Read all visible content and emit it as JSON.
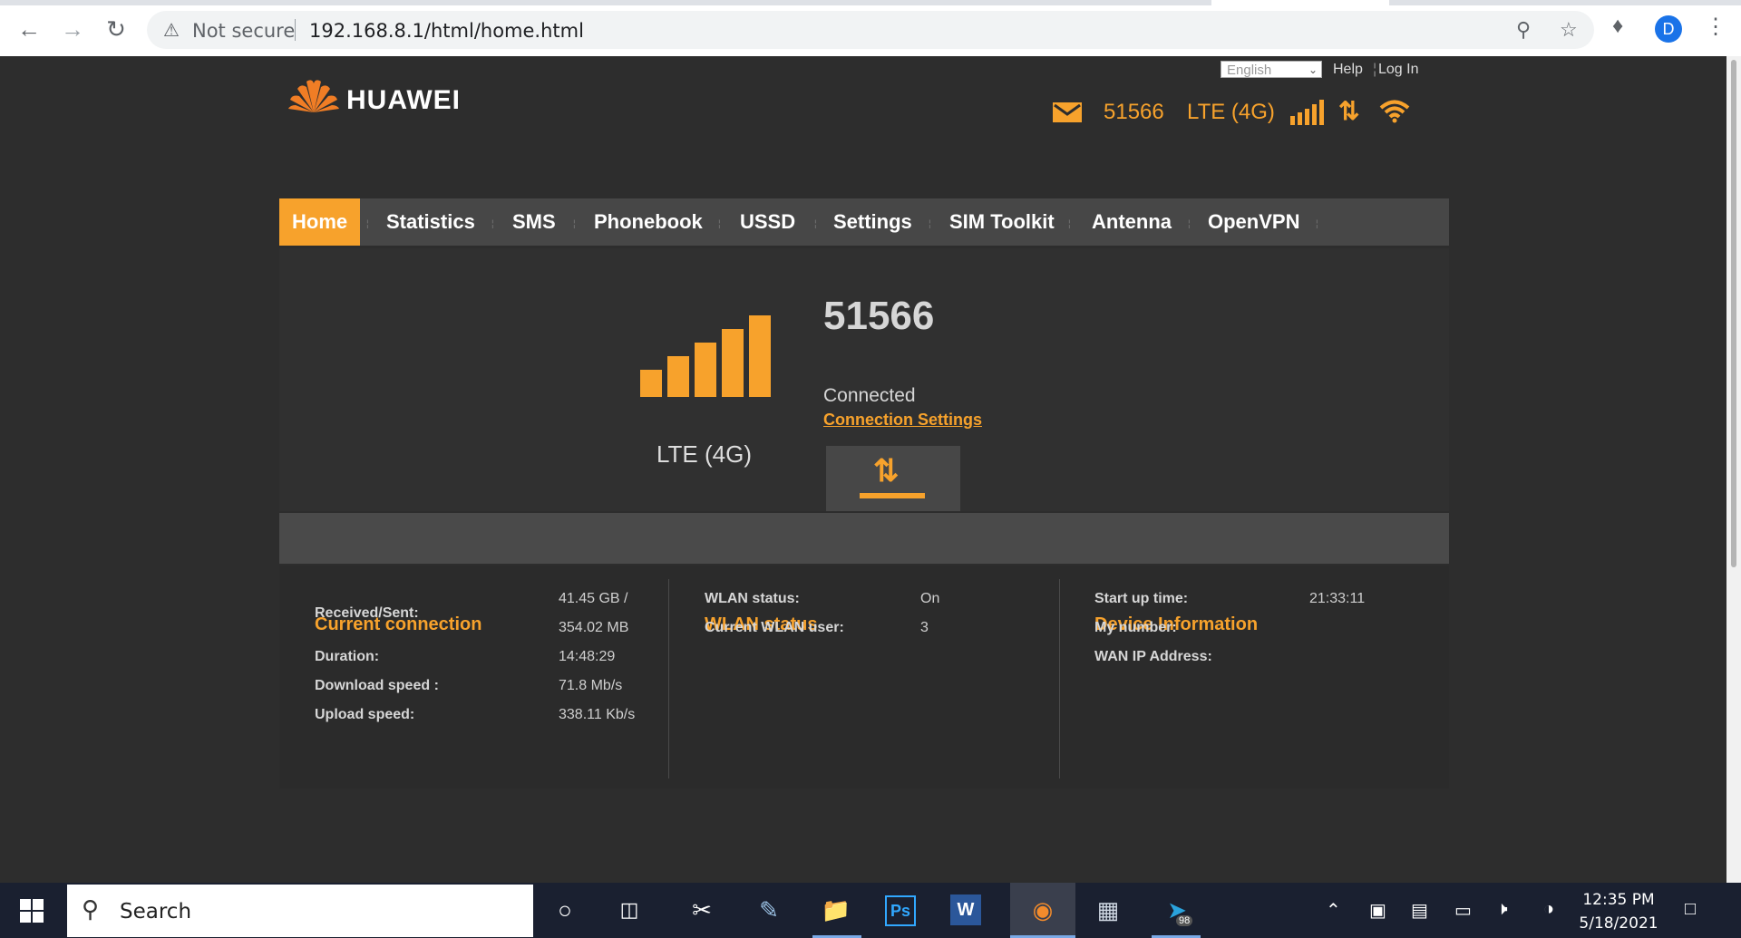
{
  "browser": {
    "security_label": "Not secure",
    "url": "192.168.8.1/html/home.html",
    "profile_initial": "D"
  },
  "header": {
    "brand": "HUAWEI",
    "language": "English",
    "help_label": "Help",
    "login_label": "Log In",
    "operator": "51566",
    "network_type": "LTE (4G)"
  },
  "nav": {
    "items": [
      "Home",
      "Statistics",
      "SMS",
      "Phonebook",
      "USSD",
      "Settings",
      "SIM Toolkit",
      "Antenna",
      "OpenVPN"
    ],
    "active": "Home"
  },
  "hero": {
    "operator": "51566",
    "status": "Connected",
    "settings_link": "Connection Settings",
    "network_type": "LTE (4G)",
    "signal_bars": 5
  },
  "current_connection": {
    "title": "Current connection",
    "received_sent_label": "Received/Sent:",
    "received": "41.45 GB /",
    "sent": "354.02 MB",
    "duration_label": "Duration:",
    "duration": "14:48:29",
    "download_label": "Download speed :",
    "download": "71.8 Mb/s",
    "upload_label": "Upload speed:",
    "upload": "338.11 Kb/s"
  },
  "wlan": {
    "title": "WLAN status",
    "status_label": "WLAN status:",
    "status": "On",
    "users_label": "Current WLAN user:",
    "users": "3"
  },
  "device": {
    "title": "Device Information",
    "startup_label": "Start up time:",
    "startup": "21:33:11",
    "number_label": "My number:",
    "wan_label": "WAN IP Address:"
  },
  "taskbar": {
    "search_placeholder": "Search",
    "telegram_badge": "98",
    "time": "12:35 PM",
    "date": "5/18/2021"
  },
  "colors": {
    "accent": "#f7a22c",
    "page_bg": "#2d2d2d",
    "nav_bg": "#474747"
  }
}
